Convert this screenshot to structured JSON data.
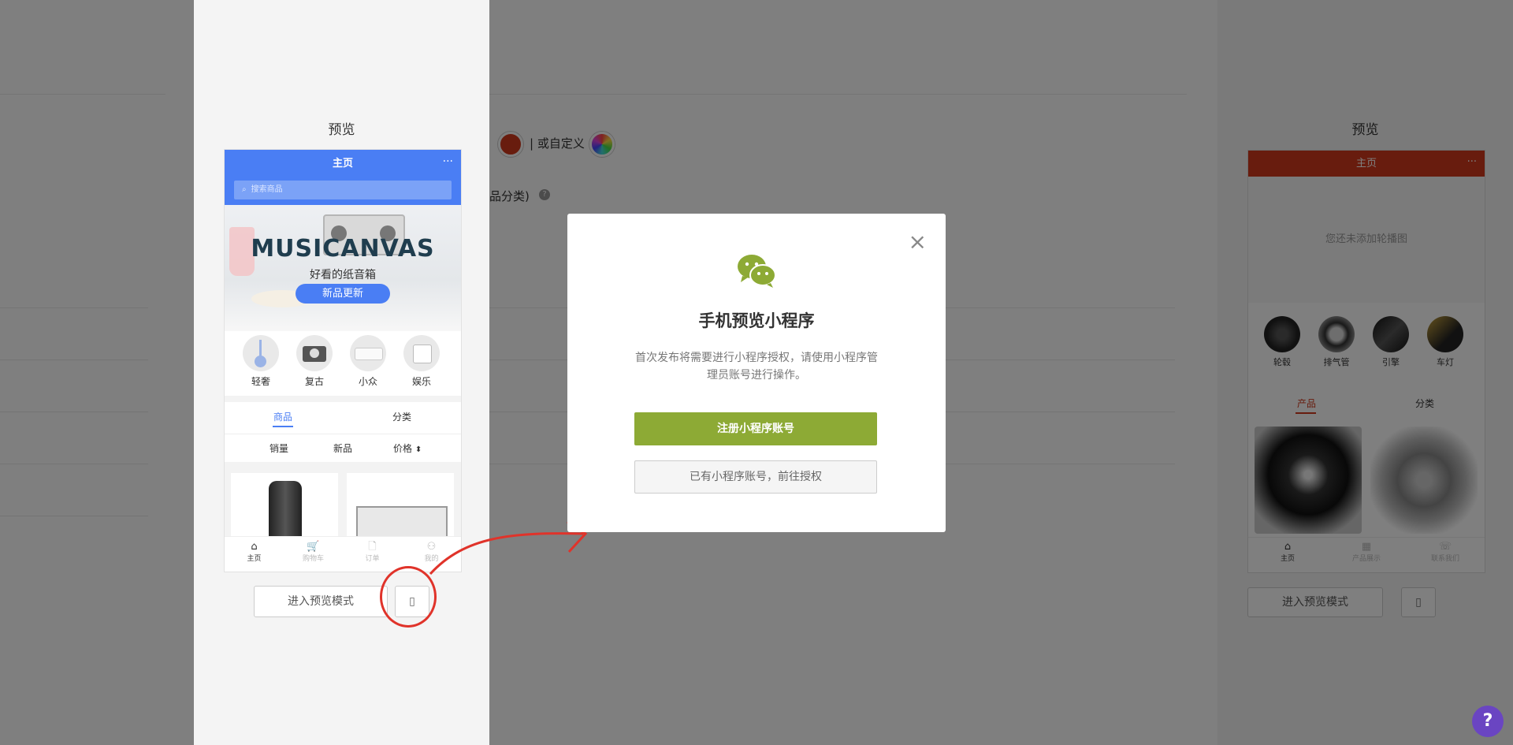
{
  "background": {
    "or_custom_label": "| 或自定义",
    "category_hint": "品分类)",
    "help_icon": "?",
    "right_preview": {
      "title": "预览",
      "header_title": "主页",
      "menu_dots": "···",
      "empty_banner": "您还未添加轮播图",
      "categories": [
        "轮毂",
        "排气管",
        "引擎",
        "车灯"
      ],
      "tabs": [
        "产品",
        "分类"
      ],
      "nav": [
        {
          "icon": "⌂",
          "label": "主页"
        },
        {
          "icon": "▦",
          "label": "产品展示"
        },
        {
          "icon": "☏",
          "label": "联系我们"
        }
      ],
      "preview_button": "进入预览模式",
      "phone_icon": "▯"
    },
    "accent_color": "#d0381c"
  },
  "preview": {
    "title": "预览",
    "header_title": "主页",
    "menu_dots": "···",
    "search_placeholder": "搜索商品",
    "search_icon": "⌕",
    "banner": {
      "title": "MUSICANVAS",
      "subtitle": "好看的纸音箱",
      "button": "新品更新"
    },
    "categories": [
      "轻奢",
      "复古",
      "小众",
      "娱乐"
    ],
    "tabs": [
      "商品",
      "分类"
    ],
    "sort": [
      "销量",
      "新品",
      "价格"
    ],
    "sort_icon": "⬍",
    "nav": [
      {
        "icon": "⌂",
        "label": "主页"
      },
      {
        "icon": "🛒",
        "label": "购物车"
      },
      {
        "icon": "🗋",
        "label": "订单"
      },
      {
        "icon": "⚇",
        "label": "我的"
      }
    ],
    "preview_button": "进入预览模式",
    "phone_icon": "▯",
    "brand_color": "#4a7ef4"
  },
  "modal": {
    "close_icon": "×",
    "title": "手机预览小程序",
    "description": "首次发布将需要进行小程序授权，请使用小程序管理员账号进行操作。",
    "register_button": "注册小程序账号",
    "authorize_button": "已有小程序账号，前往授权",
    "primary_color": "#8daa35"
  }
}
